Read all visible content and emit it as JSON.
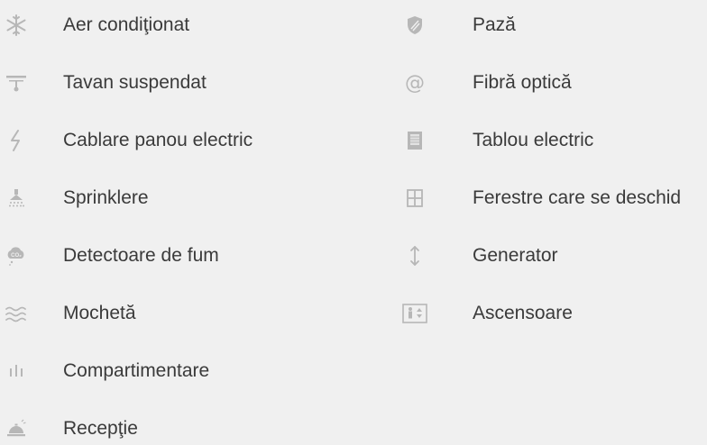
{
  "amenities_left": [
    {
      "label": "Aer condiţionat",
      "icon": "snowflake-icon"
    },
    {
      "label": "Tavan suspendat",
      "icon": "ceiling-icon"
    },
    {
      "label": "Cablare panou electric",
      "icon": "lightning-icon"
    },
    {
      "label": "Sprinklere",
      "icon": "sprinkler-icon"
    },
    {
      "label": "Detectoare de fum",
      "icon": "smoke-detector-icon"
    },
    {
      "label": "Mochetă",
      "icon": "carpet-icon"
    },
    {
      "label": "Compartimentare",
      "icon": "partition-icon"
    },
    {
      "label": "Recepţie",
      "icon": "reception-bell-icon"
    }
  ],
  "amenities_right": [
    {
      "label": "Pază",
      "icon": "shield-icon"
    },
    {
      "label": "Fibră optică",
      "icon": "at-sign-icon"
    },
    {
      "label": "Tablou electric",
      "icon": "electric-panel-icon"
    },
    {
      "label": "Ferestre care se deschid",
      "icon": "window-icon"
    },
    {
      "label": "Generator",
      "icon": "vertical-arrows-icon"
    },
    {
      "label": "Ascensoare",
      "icon": "elevator-icon"
    }
  ],
  "icon_color": "#b7b7b7",
  "text_color": "#3a3a3a",
  "background_color": "#f0f0f0"
}
